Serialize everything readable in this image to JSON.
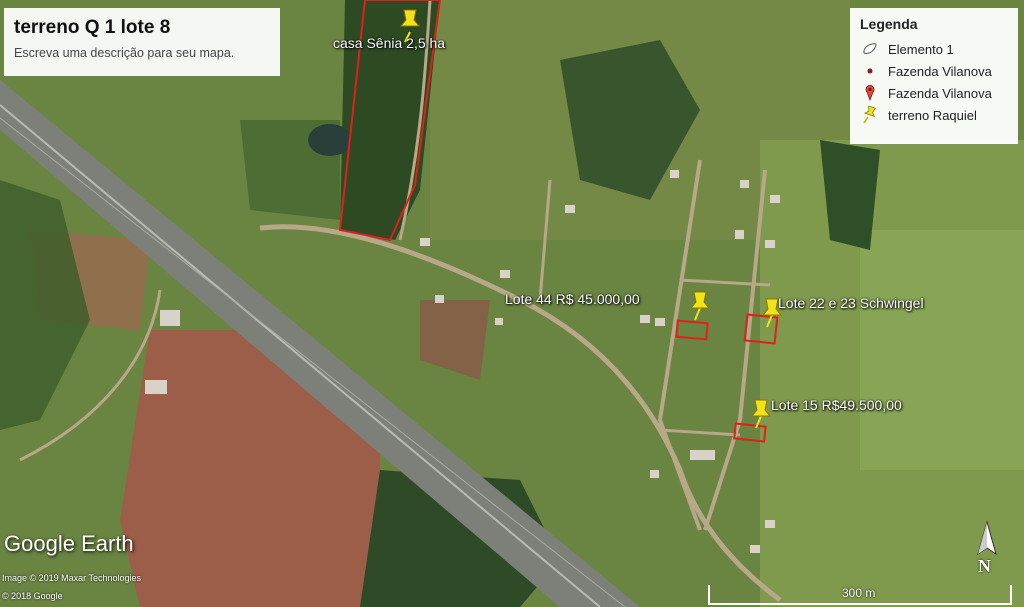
{
  "map": {
    "title": "terreno Q 1 lote 8",
    "description": "Escreva uma descrição para seu mapa."
  },
  "legend": {
    "title": "Legenda",
    "items": [
      {
        "label": "Elemento 1",
        "icon": "polygon-icon"
      },
      {
        "label": "Fazenda Vilanova",
        "icon": "dot-icon",
        "color": "#8b1a1a"
      },
      {
        "label": "Fazenda Vilanova",
        "icon": "map-pin-icon",
        "color": "#e04a3a"
      },
      {
        "label": "terreno Raquiel",
        "icon": "yellow-pushpin-icon",
        "color": "#f2e21a"
      }
    ]
  },
  "placemarks": [
    {
      "label": "casa Sênia 2,5 ha"
    },
    {
      "label": "Lote 44 R$ 45.000,00"
    },
    {
      "label": "Lote 22 e 23 Schwingel"
    },
    {
      "label": "Lote 15 R$49.500,00"
    }
  ],
  "overlay": {
    "logo_google": "Google",
    "logo_earth": "Earth",
    "credit_imagery": "Image © 2019 Maxar Technologies",
    "credit_google": "© 2018 Google",
    "scale_label": "300 m",
    "compass_label": "N"
  },
  "colors": {
    "boundary": "#e0201c",
    "pin": "#f2e21a"
  }
}
